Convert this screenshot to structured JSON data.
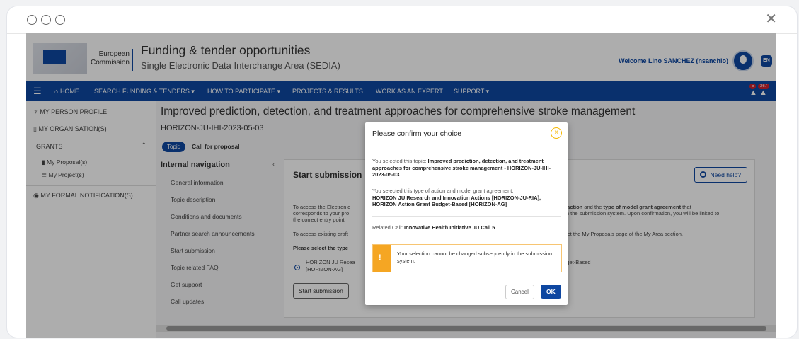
{
  "header": {
    "ec_line1": "European",
    "ec_line2": "Commission",
    "portal_title": "Funding & tender opportunities",
    "portal_subtitle": "Single Electronic Data Interchange Area (SEDIA)",
    "welcome": "Welcome Lino SANCHEZ (nsanchlo)",
    "lang": "EN"
  },
  "nav": {
    "home": "HOME",
    "search": "SEARCH FUNDING & TENDERS ▾",
    "participate": "HOW TO PARTICIPATE ▾",
    "projects": "PROJECTS & RESULTS",
    "expert": "WORK AS AN EXPERT",
    "support": "SUPPORT ▾",
    "badge_a": "5",
    "badge_b": "267"
  },
  "sidebar": {
    "person": "MY PERSON PROFILE",
    "organisation": "MY ORGANISATION(S)",
    "grants": "GRANTS",
    "proposals": "My Proposal(s)",
    "projects": "My Project(s)",
    "notifications": "MY FORMAL NOTIFICATION(S)"
  },
  "topic": {
    "title": "Improved prediction, detection, and treatment approaches for comprehensive stroke management",
    "id": "HORIZON-JU-IHI-2023-05-03",
    "chip": "Topic",
    "chip_label": "Call for proposal"
  },
  "internal_nav": {
    "title": "Internal navigation",
    "items": [
      "General information",
      "Topic description",
      "Conditions and documents",
      "Partner search announcements",
      "Start submission",
      "Topic related FAQ",
      "Get support",
      "Call updates"
    ]
  },
  "panel": {
    "title": "Start submission",
    "help": "Need help?",
    "line1": "To access the Electronic",
    "line1b": "of action",
    "line1c": "and the",
    "line1d": "type of model grant agreement",
    "line1e": "that",
    "line2": "corresponds to your pro",
    "line2b": "d in the submission system. Upon confirmation, you will be linked to",
    "line3": "the correct entry point.",
    "line4": "To access existing draft",
    "line4b": "elect the My Proposals page of the My Area section.",
    "select_label": "Please select the type",
    "radio_line1": "HORIZON JU Resea",
    "radio_line2": "[HORIZON-AG]",
    "radio_tail": "udget-Based",
    "start_button": "Start submission"
  },
  "modal": {
    "title": "Please confirm your choice",
    "topic_intro": "You selected this topic:",
    "topic_value": "Improved prediction, detection, and treatment approaches for comprehensive stroke management - HORIZON-JU-IHI-2023-05-03",
    "action_intro": "You selected this type of action and model grant agreement:",
    "action_value": "HORIZON JU Research and Innovation Actions [HORIZON-JU-RIA], HORIZON Action Grant Budget-Based [HORIZON-AG]",
    "call_intro": "Related Call:",
    "call_value": "Innovative Health Initiative JU Call 5",
    "warning": "Your selection cannot be changed subsequently in the submission system.",
    "cancel": "Cancel",
    "ok": "OK"
  }
}
